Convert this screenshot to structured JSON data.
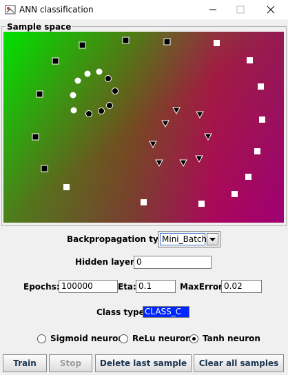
{
  "window": {
    "title": "ANN classification"
  },
  "panel": {
    "title": "Sample space"
  },
  "controls": {
    "backprop_label": "Backpropagation type:",
    "backprop_value": "Mini_Batch",
    "hidden_label": "Hidden layers:",
    "hidden_value": "0",
    "epochs_label": "Epochs:",
    "epochs_value": "100000",
    "eta_label": "Eta:",
    "eta_value": "0.1",
    "maxerror_label": "MaxError:",
    "maxerror_value": "0.02",
    "class_label": "Class type:",
    "class_value": "CLASS_C"
  },
  "radios": [
    {
      "label": "Sigmoid neuron",
      "selected": false
    },
    {
      "label": "ReLu neuron",
      "selected": false
    },
    {
      "label": "Tanh neuron",
      "selected": true
    }
  ],
  "buttons": {
    "train": "Train",
    "stop": "Stop",
    "delete": "Delete last sample",
    "clear": "Clear all samples"
  },
  "colors": {
    "class_a": "#000000",
    "class_b": "#ffffff",
    "gradient_green": "#00e400",
    "gradient_magenta": "#9e006c",
    "class_highlight": "#0026ff"
  }
}
